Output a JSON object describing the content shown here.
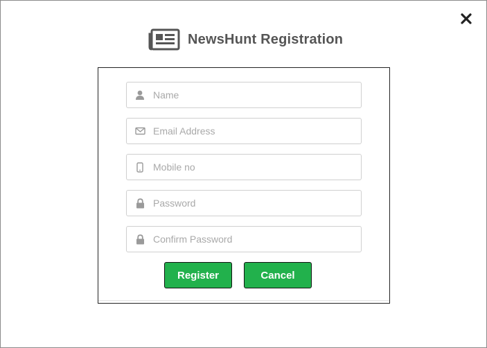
{
  "dialog": {
    "title": "NewsHunt Registration",
    "logo_icon": "newspaper-icon",
    "close_icon": "close-icon"
  },
  "form": {
    "fields": [
      {
        "id": "name",
        "icon": "user-icon",
        "placeholder": "Name",
        "value": ""
      },
      {
        "id": "email",
        "icon": "envelope-icon",
        "placeholder": "Email Address",
        "value": ""
      },
      {
        "id": "mobile",
        "icon": "mobile-phone-icon",
        "placeholder": "Mobile no",
        "value": ""
      },
      {
        "id": "password",
        "icon": "lock-icon",
        "placeholder": "Password",
        "value": ""
      },
      {
        "id": "confirm_password",
        "icon": "lock-icon",
        "placeholder": "Confirm Password",
        "value": ""
      }
    ],
    "register_label": "Register",
    "cancel_label": "Cancel"
  },
  "colors": {
    "button_green": "#22b14c",
    "title_gray": "#555555",
    "placeholder_gray": "#a9a9a9"
  }
}
